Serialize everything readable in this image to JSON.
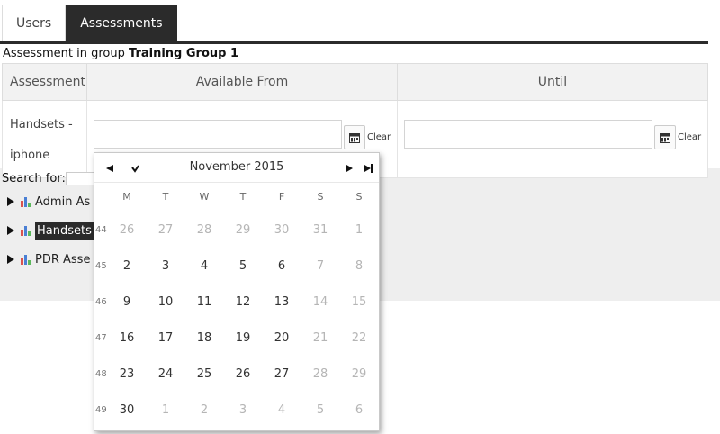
{
  "tabs": [
    {
      "label": "Users",
      "active": false
    },
    {
      "label": "Assessments",
      "active": true
    }
  ],
  "group_line": {
    "prefix": "Assessment in group",
    "group": "Training Group 1"
  },
  "table": {
    "headers": [
      "Assessment",
      "Available From",
      "Until"
    ],
    "row": {
      "name_line1": "Handsets -",
      "name_line2": "iphone",
      "from_value": "",
      "until_value": "",
      "clear_label": "Clear"
    }
  },
  "search": {
    "label": "Search for:",
    "value": ""
  },
  "tree": [
    {
      "label": "Admin As",
      "selected": false
    },
    {
      "label": "Handsets",
      "selected": true
    },
    {
      "label": "PDR Asse",
      "selected": false
    }
  ],
  "datepicker": {
    "title": "November 2015",
    "weekdays": [
      "M",
      "T",
      "W",
      "T",
      "F",
      "S",
      "S"
    ],
    "weeks": [
      {
        "num": "44",
        "days": [
          {
            "d": "26",
            "m": true
          },
          {
            "d": "27",
            "m": true
          },
          {
            "d": "28",
            "m": true
          },
          {
            "d": "29",
            "m": true
          },
          {
            "d": "30",
            "m": true
          },
          {
            "d": "31",
            "m": true
          },
          {
            "d": "1",
            "m": true
          }
        ]
      },
      {
        "num": "45",
        "days": [
          {
            "d": "2",
            "m": false
          },
          {
            "d": "3",
            "m": false
          },
          {
            "d": "4",
            "m": false
          },
          {
            "d": "5",
            "m": false
          },
          {
            "d": "6",
            "m": false
          },
          {
            "d": "7",
            "m": true
          },
          {
            "d": "8",
            "m": true
          }
        ]
      },
      {
        "num": "46",
        "days": [
          {
            "d": "9",
            "m": false
          },
          {
            "d": "10",
            "m": false
          },
          {
            "d": "11",
            "m": false
          },
          {
            "d": "12",
            "m": false
          },
          {
            "d": "13",
            "m": false
          },
          {
            "d": "14",
            "m": true
          },
          {
            "d": "15",
            "m": true
          }
        ]
      },
      {
        "num": "47",
        "days": [
          {
            "d": "16",
            "m": false
          },
          {
            "d": "17",
            "m": false
          },
          {
            "d": "18",
            "m": false
          },
          {
            "d": "19",
            "m": false
          },
          {
            "d": "20",
            "m": false
          },
          {
            "d": "21",
            "m": true
          },
          {
            "d": "22",
            "m": true
          }
        ]
      },
      {
        "num": "48",
        "days": [
          {
            "d": "23",
            "m": false
          },
          {
            "d": "24",
            "m": false
          },
          {
            "d": "25",
            "m": false
          },
          {
            "d": "26",
            "m": false
          },
          {
            "d": "27",
            "m": false
          },
          {
            "d": "28",
            "m": true
          },
          {
            "d": "29",
            "m": true
          }
        ]
      },
      {
        "num": "49",
        "days": [
          {
            "d": "30",
            "m": false
          },
          {
            "d": "1",
            "m": true
          },
          {
            "d": "2",
            "m": true
          },
          {
            "d": "3",
            "m": true
          },
          {
            "d": "4",
            "m": true
          },
          {
            "d": "5",
            "m": true
          },
          {
            "d": "6",
            "m": true
          }
        ]
      }
    ]
  },
  "colors": {
    "dark": "#2b2b2b",
    "muted_day": "#b5b5b5"
  },
  "icons": [
    "calendar-icon",
    "bar-chart-icon",
    "tree-expand-arrow-icon",
    "prev-year-icon",
    "prev-month-icon",
    "next-month-icon",
    "next-year-icon"
  ]
}
